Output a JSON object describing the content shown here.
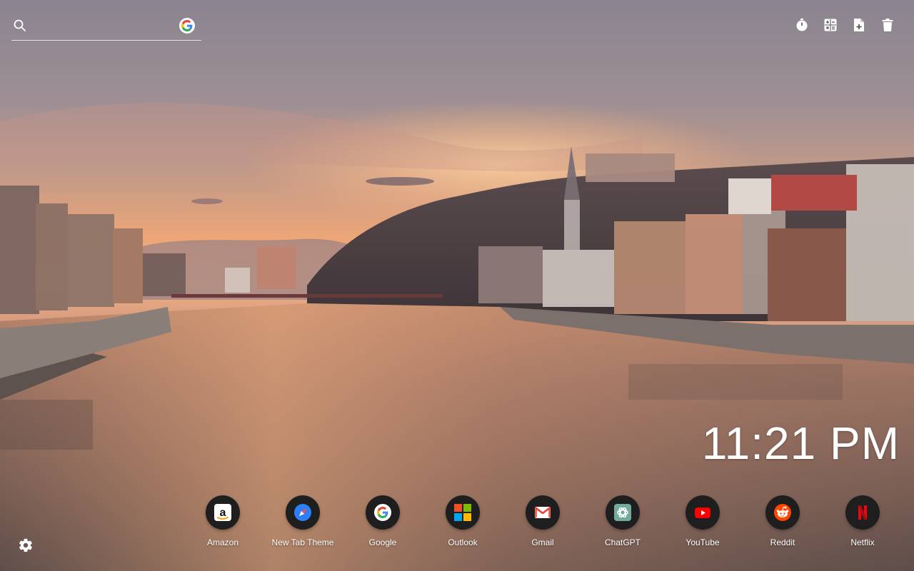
{
  "search": {
    "placeholder": "",
    "value": "",
    "engine_icon": "google-icon"
  },
  "toolbar": {
    "items": [
      {
        "icon": "stopwatch-icon"
      },
      {
        "icon": "calculator-icon"
      },
      {
        "icon": "add-note-icon"
      },
      {
        "icon": "trash-icon"
      }
    ]
  },
  "clock": {
    "time": "11:21 PM"
  },
  "shortcuts": [
    {
      "label": "Amazon",
      "icon": "amazon-icon"
    },
    {
      "label": "New Tab Theme",
      "icon": "compass-icon"
    },
    {
      "label": "Google",
      "icon": "google-icon"
    },
    {
      "label": "Outlook",
      "icon": "microsoft-icon"
    },
    {
      "label": "Gmail",
      "icon": "gmail-icon"
    },
    {
      "label": "ChatGPT",
      "icon": "chatgpt-icon"
    },
    {
      "label": "YouTube",
      "icon": "youtube-icon"
    },
    {
      "label": "Reddit",
      "icon": "reddit-icon"
    },
    {
      "label": "Netflix",
      "icon": "netflix-icon"
    }
  ],
  "settings": {
    "icon": "gear-icon"
  },
  "colors": {
    "sky_top": "#8e8893",
    "sky_glow": "#f0a06a",
    "water": "#7a5e52",
    "shortcut_bg": "#1e1e1e",
    "google_blue": "#4285F4",
    "google_red": "#EA4335",
    "google_yellow": "#FBBC05",
    "google_green": "#34A853",
    "youtube_red": "#FF0000",
    "reddit_orange": "#FF4500",
    "netflix_red": "#E50914",
    "chatgpt_teal": "#74AA9C"
  }
}
